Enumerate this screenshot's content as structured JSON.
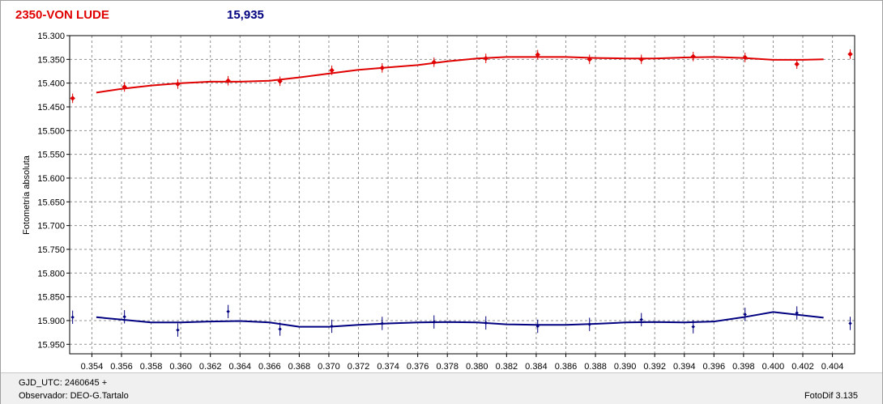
{
  "header": {
    "title": "2350-VON LUDE",
    "value": "15,935"
  },
  "footer": {
    "gjd": "GJD_UTC: 2460645 +",
    "observer": "Observador: DEO-G.Tartalo",
    "version": "FotoDif 3.135"
  },
  "colors": {
    "series_red": "#e00000",
    "series_blue": "#000080",
    "grid": "#909090"
  },
  "chart_data": {
    "type": "scatter",
    "ylabel": "Fotometría absoluta",
    "xlabel": "",
    "xlim": [
      0.3525,
      0.4055
    ],
    "ylim": [
      15.3,
      15.97
    ],
    "y_inverted": true,
    "grid": true,
    "x_ticks": [
      "0.354",
      "0.356",
      "0.358",
      "0.360",
      "0.362",
      "0.364",
      "0.366",
      "0.368",
      "0.370",
      "0.372",
      "0.374",
      "0.376",
      "0.378",
      "0.380",
      "0.382",
      "0.384",
      "0.386",
      "0.388",
      "0.390",
      "0.392",
      "0.394",
      "0.396",
      "0.398",
      "0.400",
      "0.402",
      "0.404"
    ],
    "y_ticks": [
      "15.300",
      "15.350",
      "15.400",
      "15.450",
      "15.500",
      "15.550",
      "15.600",
      "15.650",
      "15.700",
      "15.750",
      "15.800",
      "15.850",
      "15.900",
      "15.950"
    ],
    "series": [
      {
        "color": "#e00000",
        "points": [
          [
            0.3527,
            15.432
          ],
          [
            0.3562,
            15.408
          ],
          [
            0.3598,
            15.402
          ],
          [
            0.3632,
            15.395
          ],
          [
            0.3667,
            15.396
          ],
          [
            0.3702,
            15.373
          ],
          [
            0.3736,
            15.368
          ],
          [
            0.3771,
            15.356
          ],
          [
            0.3806,
            15.348
          ],
          [
            0.3841,
            15.34
          ],
          [
            0.3876,
            15.35
          ],
          [
            0.3911,
            15.35
          ],
          [
            0.3946,
            15.344
          ],
          [
            0.3981,
            15.346
          ],
          [
            0.4016,
            15.36
          ],
          [
            0.4052,
            15.339
          ]
        ],
        "fit": [
          [
            0.3543,
            15.42
          ],
          [
            0.356,
            15.412
          ],
          [
            0.358,
            15.405
          ],
          [
            0.36,
            15.4
          ],
          [
            0.362,
            15.397
          ],
          [
            0.364,
            15.397
          ],
          [
            0.366,
            15.395
          ],
          [
            0.368,
            15.388
          ],
          [
            0.37,
            15.38
          ],
          [
            0.372,
            15.372
          ],
          [
            0.374,
            15.367
          ],
          [
            0.376,
            15.362
          ],
          [
            0.378,
            15.354
          ],
          [
            0.38,
            15.348
          ],
          [
            0.382,
            15.345
          ],
          [
            0.384,
            15.345
          ],
          [
            0.386,
            15.345
          ],
          [
            0.388,
            15.347
          ],
          [
            0.39,
            15.348
          ],
          [
            0.392,
            15.348
          ],
          [
            0.394,
            15.346
          ],
          [
            0.396,
            15.345
          ],
          [
            0.398,
            15.347
          ],
          [
            0.4,
            15.351
          ],
          [
            0.402,
            15.351
          ],
          [
            0.4034,
            15.35
          ]
        ],
        "err": 0.01
      },
      {
        "color": "#000080",
        "points": [
          [
            0.3527,
            15.893
          ],
          [
            0.3562,
            15.892
          ],
          [
            0.3598,
            15.92
          ],
          [
            0.3632,
            15.881
          ],
          [
            0.3667,
            15.918
          ],
          [
            0.3702,
            15.912
          ],
          [
            0.3736,
            15.906
          ],
          [
            0.3771,
            15.903
          ],
          [
            0.3806,
            15.905
          ],
          [
            0.3841,
            15.912
          ],
          [
            0.3876,
            15.908
          ],
          [
            0.3911,
            15.898
          ],
          [
            0.3946,
            15.913
          ],
          [
            0.3981,
            15.887
          ],
          [
            0.4016,
            15.884
          ],
          [
            0.4052,
            15.906
          ]
        ],
        "fit": [
          [
            0.3543,
            15.893
          ],
          [
            0.356,
            15.898
          ],
          [
            0.358,
            15.904
          ],
          [
            0.36,
            15.904
          ],
          [
            0.362,
            15.902
          ],
          [
            0.364,
            15.901
          ],
          [
            0.366,
            15.904
          ],
          [
            0.368,
            15.913
          ],
          [
            0.37,
            15.913
          ],
          [
            0.372,
            15.909
          ],
          [
            0.374,
            15.906
          ],
          [
            0.376,
            15.904
          ],
          [
            0.378,
            15.903
          ],
          [
            0.38,
            15.904
          ],
          [
            0.382,
            15.908
          ],
          [
            0.384,
            15.909
          ],
          [
            0.386,
            15.909
          ],
          [
            0.388,
            15.907
          ],
          [
            0.39,
            15.904
          ],
          [
            0.392,
            15.903
          ],
          [
            0.394,
            15.904
          ],
          [
            0.396,
            15.902
          ],
          [
            0.398,
            15.893
          ],
          [
            0.4,
            15.882
          ],
          [
            0.402,
            15.889
          ],
          [
            0.4034,
            15.894
          ]
        ],
        "err": 0.014
      }
    ]
  }
}
